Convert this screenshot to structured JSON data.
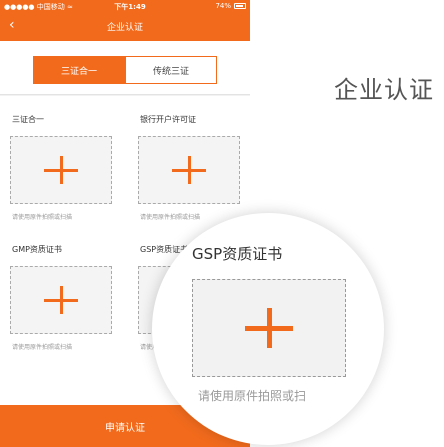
{
  "status_bar": {
    "carrier": "●●●●● 中国移动 ≈",
    "time": "下午1:49",
    "battery": "74%"
  },
  "nav": {
    "title": "企业认证"
  },
  "segment": {
    "active": "三证合一",
    "inactive": "传统三证"
  },
  "uploads": [
    {
      "label": "三证合一",
      "hint": "请使用原件拍照或扫描"
    },
    {
      "label": "银行开户许可证",
      "hint": "请使用原件拍照或扫描"
    },
    {
      "label": "GMP资质证书",
      "hint": "请使用原件拍照或扫描"
    },
    {
      "label": "GSP资质证书",
      "hint": "请使用原件拍照或扫描"
    }
  ],
  "submit": {
    "label": "申请认证"
  },
  "magnifier": {
    "label": "GSP资质证书",
    "hint": "请使用原件拍照或扫"
  },
  "side_title": "企业认证",
  "colors": {
    "accent": "#f26b1d"
  },
  "icons": [
    "back-arrow-icon",
    "plus-icon",
    "battery-icon",
    "wifi-icon"
  ]
}
